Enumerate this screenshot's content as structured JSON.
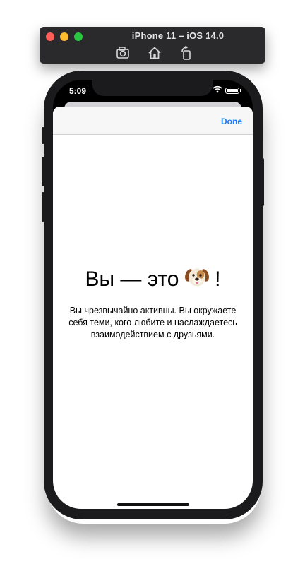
{
  "simulator": {
    "title": "iPhone 11 – iOS 14.0",
    "tools": [
      {
        "icon": "screenshot-icon"
      },
      {
        "icon": "home-icon"
      },
      {
        "icon": "rotate-icon"
      }
    ]
  },
  "status_bar": {
    "time": "5:09"
  },
  "sheet": {
    "done_label": "Done",
    "headline_text": "Вы — это",
    "headline_emoji_icon": "dog-face-icon",
    "headline_exclamation": "!",
    "description": "Вы чрезвычайно активны. Вы окружаете себя теми, кого любите и наслаждаетесь взаимодействием с друзьями."
  },
  "colors": {
    "accent": "#1a7cff",
    "device_frame": "#1b1b1d",
    "titlebar": "#2a2a2c"
  }
}
